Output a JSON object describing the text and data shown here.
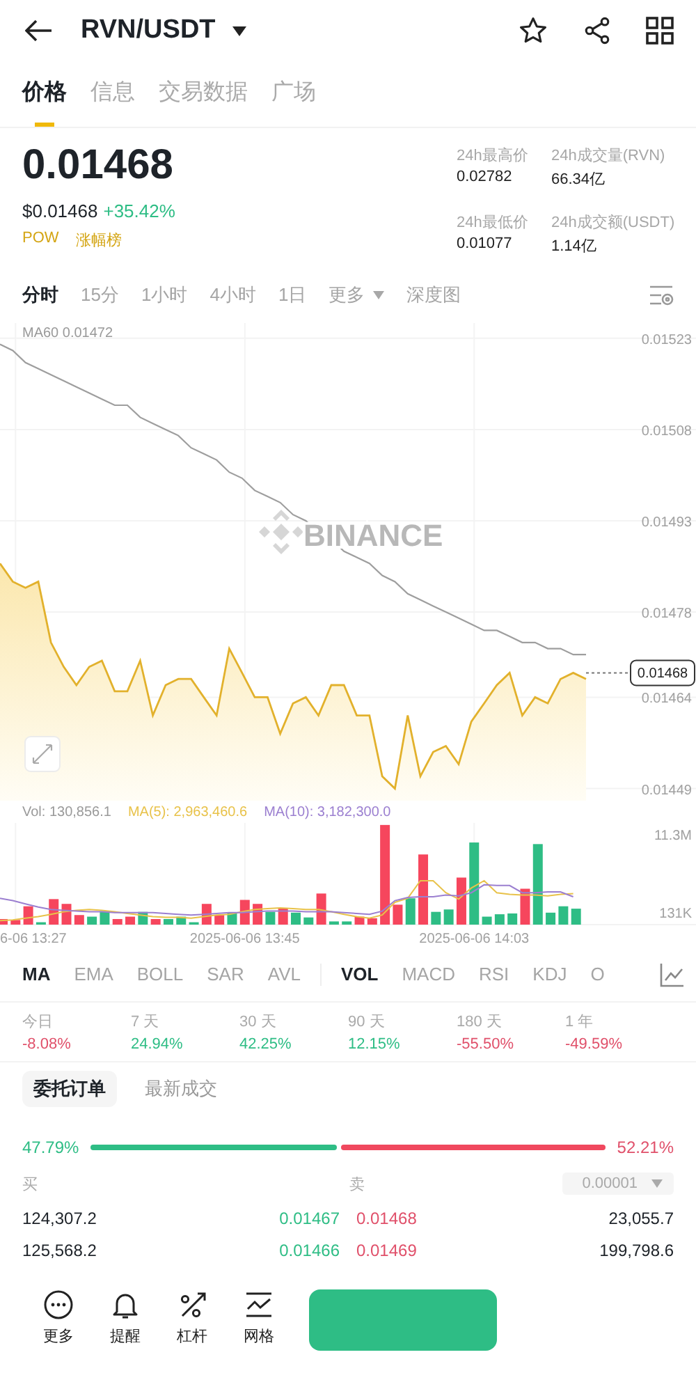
{
  "header": {
    "title": "RVN/USDT"
  },
  "tabs": [
    {
      "label": "价格",
      "selected": true
    },
    {
      "label": "信息",
      "selected": false
    },
    {
      "label": "交易数据",
      "selected": false
    },
    {
      "label": "广场",
      "selected": false
    }
  ],
  "price": {
    "last": "0.01468",
    "usd": "$0.01468",
    "change": "+35.42%",
    "tags": [
      "POW",
      "涨幅榜"
    ]
  },
  "stats": [
    {
      "label": "24h最高价",
      "value": "0.02782"
    },
    {
      "label": "24h成交量(RVN)",
      "value": "66.34亿"
    },
    {
      "label": "24h最低价",
      "value": "0.01077"
    },
    {
      "label": "24h成交额(USDT)",
      "value": "1.14亿"
    }
  ],
  "intervals": [
    {
      "label": "分时",
      "kind": "tab",
      "selected": true
    },
    {
      "label": "15分",
      "kind": "tab",
      "selected": false
    },
    {
      "label": "1小时",
      "kind": "tab",
      "selected": false
    },
    {
      "label": "4小时",
      "kind": "tab",
      "selected": false
    },
    {
      "label": "1日",
      "kind": "tab",
      "selected": false
    },
    {
      "label": "更多",
      "kind": "dropdown",
      "selected": false
    },
    {
      "label": "深度图",
      "kind": "tab",
      "selected": false
    }
  ],
  "price_chart": {
    "legend_value": "0.01472",
    "watermark": "BINANCE",
    "last_price_tag": "0.01468",
    "chart_data": {
      "type": "line",
      "grid": true,
      "ylim": [
        0.01447,
        0.015255
      ],
      "yticks": [
        0.01523,
        0.01508,
        0.01493,
        0.01478,
        0.01464,
        0.01449
      ],
      "series": [
        {
          "color": "#e2b12c",
          "values": [
            0.01486,
            0.01483,
            0.01482,
            0.01483,
            0.01473,
            0.01469,
            0.01466,
            0.01469,
            0.0147,
            0.01465,
            0.01465,
            0.0147,
            0.01461,
            0.01466,
            0.01467,
            0.01467,
            0.01464,
            0.01461,
            0.01472,
            0.01468,
            0.01464,
            0.01464,
            0.01458,
            0.01463,
            0.01464,
            0.01461,
            0.01466,
            0.01466,
            0.01461,
            0.01461,
            0.01451,
            0.01449,
            0.01461,
            0.01451,
            0.01455,
            0.01456,
            0.01453,
            0.0146,
            0.01463,
            0.01466,
            0.01468,
            0.01461,
            0.01464,
            0.01463,
            0.01467,
            0.01468,
            0.01467
          ]
        },
        {
          "name": "MA60",
          "color": "#9e9e9e",
          "values": [
            0.01522,
            0.01521,
            0.01519,
            0.01518,
            0.01517,
            0.01516,
            0.01515,
            0.01514,
            0.01513,
            0.01512,
            0.01512,
            0.0151,
            0.01509,
            0.01508,
            0.01507,
            0.01505,
            0.01504,
            0.01503,
            0.01501,
            0.015,
            0.01498,
            0.01497,
            0.01496,
            0.01494,
            0.01493,
            0.01491,
            0.0149,
            0.01488,
            0.01487,
            0.01486,
            0.01484,
            0.01483,
            0.01481,
            0.0148,
            0.01479,
            0.01478,
            0.01477,
            0.01476,
            0.01475,
            0.01475,
            0.01474,
            0.01473,
            0.01473,
            0.01472,
            0.01472,
            0.01471,
            0.01471
          ]
        }
      ]
    }
  },
  "volume_chart": {
    "legend": [
      {
        "text": "Vol: 130,856.1",
        "color": "#9a9a9a"
      },
      {
        "text": "MA(5): 2,963,460.6",
        "color": "#e8c24a"
      },
      {
        "text": "MA(10): 3,182,300.0",
        "color": "#9b7fd0"
      }
    ],
    "axis_labels": [
      "11.3M",
      "131K"
    ],
    "time_labels": [
      "6-06 13:27",
      "2025-06-06 13:45",
      "2025-06-06 14:03"
    ]
  },
  "main_indicators": [
    {
      "label": "MA",
      "selected": true
    },
    {
      "label": "EMA",
      "selected": false
    },
    {
      "label": "BOLL",
      "selected": false
    },
    {
      "label": "SAR",
      "selected": false
    },
    {
      "label": "AVL",
      "selected": false
    }
  ],
  "sub_indicators": [
    {
      "label": "VOL",
      "selected": true
    },
    {
      "label": "MACD",
      "selected": false
    },
    {
      "label": "RSI",
      "selected": false
    },
    {
      "label": "KDJ",
      "selected": false
    },
    {
      "label": "O",
      "selected": false
    }
  ],
  "performance": [
    {
      "period": "今日",
      "change": "-8.08%",
      "color": "#e0506a"
    },
    {
      "period": "7 天",
      "change": "24.94%",
      "color": "#2ebd85"
    },
    {
      "period": "30 天",
      "change": "42.25%",
      "color": "#2ebd85"
    },
    {
      "period": "90 天",
      "change": "12.15%",
      "color": "#2ebd85"
    },
    {
      "period": "180 天",
      "change": "-55.50%",
      "color": "#e0506a"
    },
    {
      "period": "1 年",
      "change": "-49.59%",
      "color": "#e0506a"
    }
  ],
  "order_tabs": [
    {
      "label": "委托订单",
      "selected": true
    },
    {
      "label": "最新成交",
      "selected": false
    }
  ],
  "ratio": {
    "buy": "47.79%",
    "sell": "52.21%",
    "level": 0.4779
  },
  "book_header": {
    "buy": "买",
    "sell": "卖",
    "precision": "0.00001"
  },
  "book_rows": [
    {
      "bid_qty": "124,307.2",
      "bid": "0.01467",
      "ask": "0.01468",
      "ask_qty": "23,055.7"
    },
    {
      "bid_qty": "125,568.2",
      "bid": "0.01466",
      "ask": "0.01469",
      "ask_qty": "199,798.6"
    }
  ],
  "bottom_nav": [
    {
      "label": "更多",
      "kind": "more"
    },
    {
      "label": "提醒",
      "kind": "alert"
    },
    {
      "label": "杠杆",
      "kind": "leverage"
    },
    {
      "label": "网格",
      "kind": "grid"
    }
  ]
}
